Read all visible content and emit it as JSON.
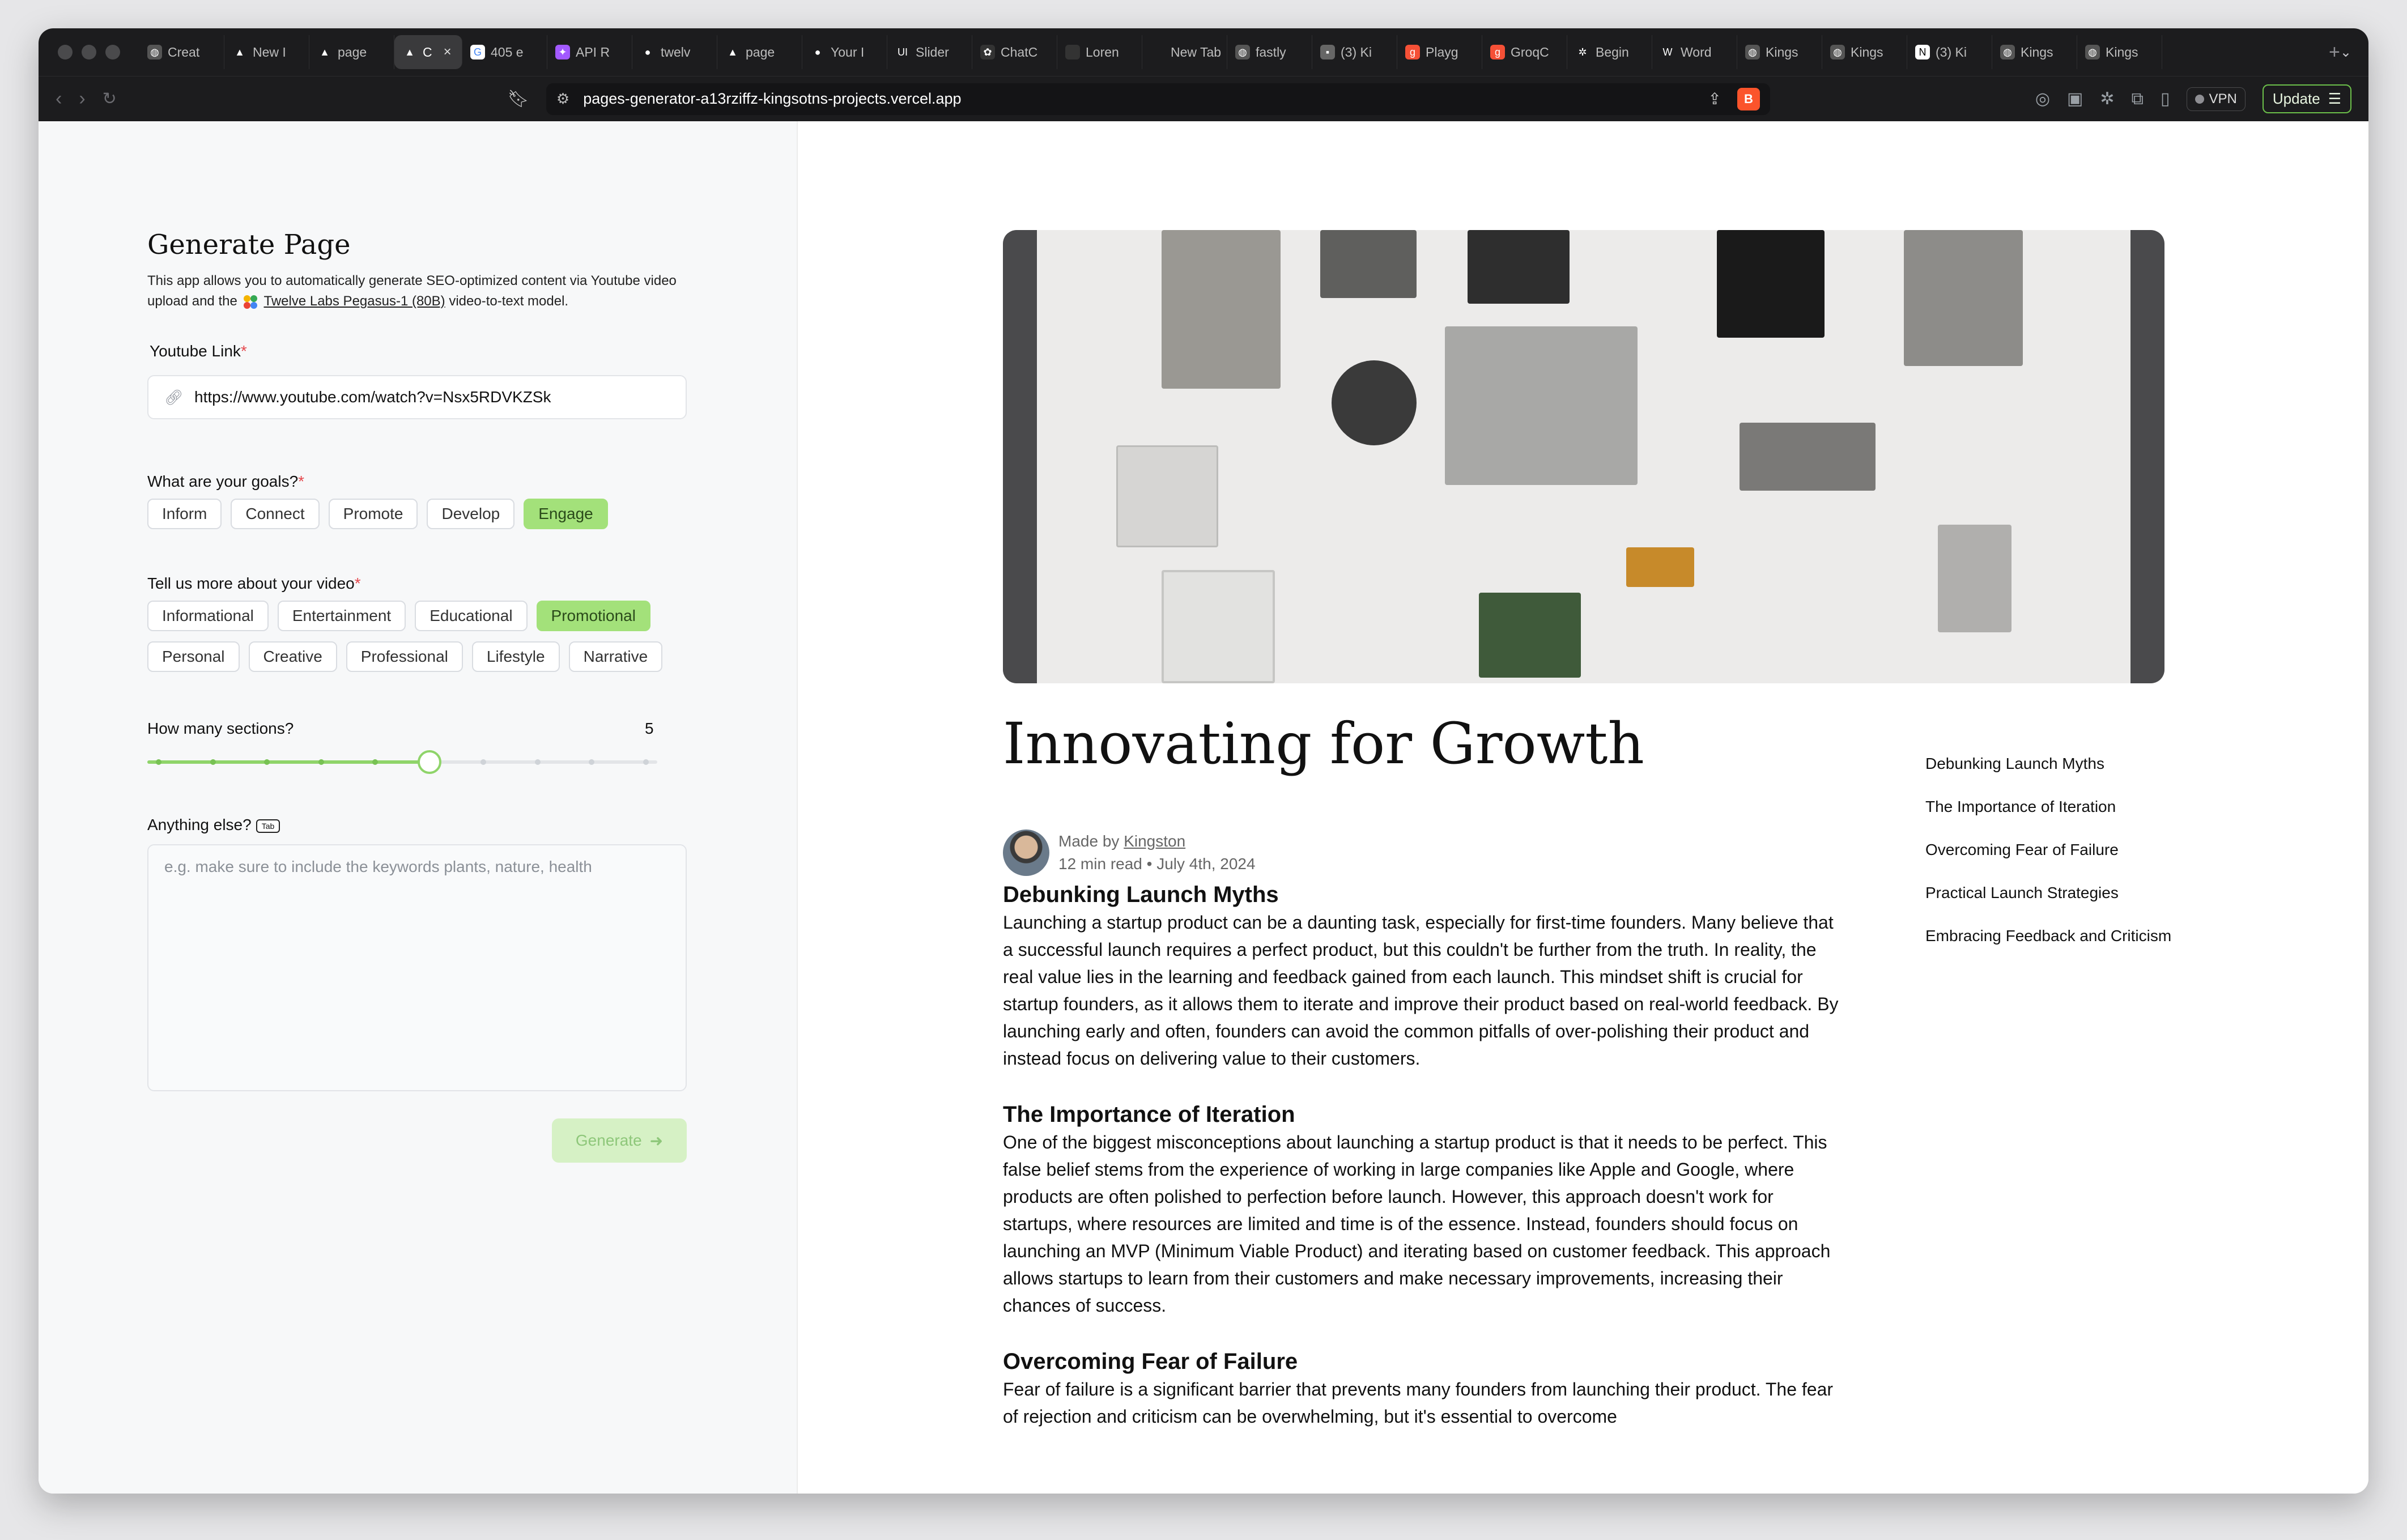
{
  "browser": {
    "tabs": [
      {
        "label": "Creat",
        "icon": "globe-icon"
      },
      {
        "label": "New I",
        "icon": "vercel-icon"
      },
      {
        "label": "page",
        "icon": "vercel-icon"
      },
      {
        "label": "C",
        "icon": "vercel-icon",
        "active": true
      },
      {
        "label": "405 e",
        "icon": "google-icon"
      },
      {
        "label": "API R",
        "icon": "figma-icon"
      },
      {
        "label": "twelv",
        "icon": "github-icon"
      },
      {
        "label": "page",
        "icon": "vercel-icon"
      },
      {
        "label": "Your I",
        "icon": "github-icon"
      },
      {
        "label": "Slider",
        "icon": "ui-icon"
      },
      {
        "label": "ChatC",
        "icon": "openai-icon"
      },
      {
        "label": "Loren",
        "icon": "blank-icon"
      },
      {
        "label": "New Tab",
        "icon": "none"
      },
      {
        "label": "fastly",
        "icon": "globe-icon"
      },
      {
        "label": "(3) Ki",
        "icon": "image-icon"
      },
      {
        "label": "Playg",
        "icon": "groq-icon"
      },
      {
        "label": "GroqC",
        "icon": "groq-icon"
      },
      {
        "label": "Begin",
        "icon": "settings-icon"
      },
      {
        "label": "Word",
        "icon": "w-icon"
      },
      {
        "label": "Kings",
        "icon": "globe-icon"
      },
      {
        "label": "Kings",
        "icon": "globe-icon"
      },
      {
        "label": "(3) Ki",
        "icon": "notion-icon"
      },
      {
        "label": "Kings",
        "icon": "globe-icon"
      },
      {
        "label": "Kings",
        "icon": "globe-icon"
      }
    ],
    "url": "pages-generator-a13rziffz-kingsotns-projects.vercel.app",
    "vpn_label": "VPN",
    "update_label": "Update"
  },
  "form": {
    "title": "Generate Page",
    "desc_part1": "This app allows you to automatically generate SEO-optimized content via Youtube video upload and the",
    "desc_link": "Twelve Labs Pegasus-1 (80B)",
    "desc_part2": "video-to-text model.",
    "youtube_label": "Youtube Link",
    "youtube_value": "https://www.youtube.com/watch?v=Nsx5RDVKZSk",
    "goals_label": "What are your goals?",
    "goals": [
      {
        "label": "Inform",
        "selected": false
      },
      {
        "label": "Connect",
        "selected": false
      },
      {
        "label": "Promote",
        "selected": false
      },
      {
        "label": "Develop",
        "selected": false
      },
      {
        "label": "Engage",
        "selected": true
      }
    ],
    "video_label": "Tell us more about your video",
    "video_types_row1": [
      {
        "label": "Informational",
        "selected": false
      },
      {
        "label": "Entertainment",
        "selected": false
      },
      {
        "label": "Educational",
        "selected": false
      },
      {
        "label": "Promotional",
        "selected": true
      }
    ],
    "video_types_row2": [
      {
        "label": "Personal",
        "selected": false
      },
      {
        "label": "Creative",
        "selected": false
      },
      {
        "label": "Professional",
        "selected": false
      },
      {
        "label": "Lifestyle",
        "selected": false
      },
      {
        "label": "Narrative",
        "selected": false
      }
    ],
    "sections_label": "How many sections?",
    "sections_value": "5",
    "sections_fraction": 0.5556,
    "anything_label": "Anything else?",
    "tab_key": "Tab",
    "anything_placeholder": "e.g. make sure to include the keywords plants, nature, health",
    "generate_label": "Generate",
    "required_mark": "*"
  },
  "article": {
    "title": "Innovating for Growth",
    "made_by": "Made by",
    "author": "Kingston",
    "meta": "12 min read • July 4th, 2024",
    "sections": [
      {
        "heading": "Debunking Launch Myths",
        "body": "Launching a startup product can be a daunting task, especially for first-time founders. Many believe that a successful launch requires a perfect product, but this couldn't be further from the truth. In reality, the real value lies in the learning and feedback gained from each launch. This mindset shift is crucial for startup founders, as it allows them to iterate and improve their product based on real-world feedback. By launching early and often, founders can avoid the common pitfalls of over-polishing their product and instead focus on delivering value to their customers."
      },
      {
        "heading": "The Importance of Iteration",
        "body": "One of the biggest misconceptions about launching a startup product is that it needs to be perfect. This false belief stems from the experience of working in large companies like Apple and Google, where products are often polished to perfection before launch. However, this approach doesn't work for startups, where resources are limited and time is of the essence. Instead, founders should focus on launching an MVP (Minimum Viable Product) and iterating based on customer feedback. This approach allows startups to learn from their customers and make necessary improvements, increasing their chances of success."
      },
      {
        "heading": "Overcoming Fear of Failure",
        "body": "Fear of failure is a significant barrier that prevents many founders from launching their product. The fear of rejection and criticism can be overwhelming, but it's essential to overcome"
      }
    ],
    "toc": [
      "Debunking Launch Myths",
      "The Importance of Iteration",
      "Overcoming Fear of Failure",
      "Practical Launch Strategies",
      "Embracing Feedback and Criticism"
    ]
  },
  "colors": {
    "accent_green": "#a3e17a",
    "required_red": "#e5484d"
  }
}
